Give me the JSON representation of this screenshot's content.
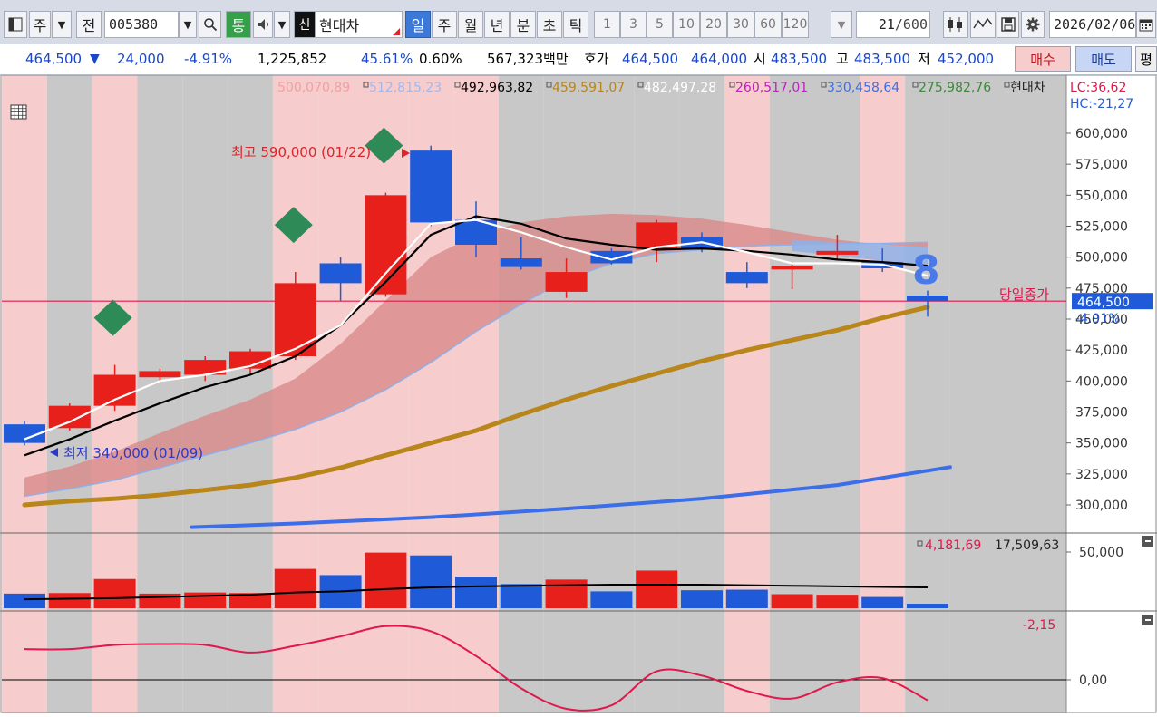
{
  "toolbar": {
    "period_select": "주",
    "prev_label": "전",
    "code_value": "005380",
    "tong_label": "통",
    "shin_badge": "신",
    "stock_name": "현대차",
    "period_tabs": [
      "일",
      "주",
      "월",
      "년",
      "분",
      "초",
      "틱"
    ],
    "active_tab": "일",
    "interval_buttons": [
      "1",
      "3",
      "5",
      "10",
      "20",
      "30",
      "60",
      "120"
    ],
    "count_value": "21",
    "count_max": "/600",
    "date_value": "2026/02/06"
  },
  "quote": {
    "price": "464,500",
    "change_arrow": "▼",
    "change": "24,000",
    "change_pct": "-4.91%",
    "volume": "1,225,852",
    "vol_ratio": "45.61%",
    "turnover": "0.60%",
    "amount": "567,323백만",
    "hoga_label": "호가",
    "ask": "464,500",
    "bid": "464,000",
    "open_label": "시",
    "open": "483,500",
    "high_label": "고",
    "high": "483,500",
    "low_label": "저",
    "low": "452,000",
    "buy_label": "매수",
    "sell_label": "매도",
    "extra_label": "평"
  },
  "colors": {
    "up": "#e8201c",
    "down": "#1f5ad8",
    "ma5": "#ffffff",
    "ma10": "#000000",
    "ma60": "#b8861a",
    "ma120": "#3b6ee8",
    "cloud": "#d98a8a",
    "band_pink": "#f6cccc",
    "band_gray": "#c8c8c8",
    "cci": "#e0184c"
  },
  "chart_data": {
    "type": "candlestick",
    "legend_values": [
      {
        "text": "500,070,89",
        "color": "#f0a0a0"
      },
      {
        "text": "512,815,23",
        "color": "#a0b8f0"
      },
      {
        "text": "492,963,82",
        "color": "#000000"
      },
      {
        "text": "459,591,07",
        "color": "#b8861a"
      },
      {
        "text": "482,497,28",
        "color": "#ffffff"
      },
      {
        "text": "260,517,01",
        "color": "#c020c0"
      },
      {
        "text": "330,458,64",
        "color": "#3b6ee8"
      },
      {
        "text": "275,982,76",
        "color": "#3a8a3a"
      }
    ],
    "legend_stock": "현대차",
    "lc_label": "LC:36,62",
    "hc_label": "HC:-21,27",
    "y_ticks": [
      600000,
      575000,
      550000,
      525000,
      500000,
      475000,
      450000,
      425000,
      400000,
      375000,
      350000,
      325000,
      300000
    ],
    "y_tick_labels": [
      "600,000",
      "575,000",
      "550,000",
      "525,000",
      "500,000",
      "475,000",
      "450,000",
      "425,000",
      "400,000",
      "375,000",
      "350,000",
      "325,000",
      "300,000"
    ],
    "ylim": [
      282000,
      623000
    ],
    "candles": [
      {
        "o": 365000,
        "h": 368000,
        "l": 348000,
        "c": 350000
      },
      {
        "o": 362000,
        "h": 382000,
        "l": 360000,
        "c": 380000
      },
      {
        "o": 380000,
        "h": 413000,
        "l": 376000,
        "c": 405000
      },
      {
        "o": 403000,
        "h": 410000,
        "l": 399000,
        "c": 408000
      },
      {
        "o": 405000,
        "h": 420000,
        "l": 400000,
        "c": 417000
      },
      {
        "o": 410000,
        "h": 426000,
        "l": 405000,
        "c": 424000
      },
      {
        "o": 420000,
        "h": 488000,
        "l": 417000,
        "c": 479000
      },
      {
        "o": 495000,
        "h": 500000,
        "l": 465000,
        "c": 479000
      },
      {
        "o": 470000,
        "h": 552000,
        "l": 468000,
        "c": 550000
      },
      {
        "o": 586000,
        "h": 590000,
        "l": 525000,
        "c": 528000
      },
      {
        "o": 530000,
        "h": 545000,
        "l": 500000,
        "c": 510000
      },
      {
        "o": 499000,
        "h": 516000,
        "l": 490000,
        "c": 492000
      },
      {
        "o": 472000,
        "h": 499000,
        "l": 467000,
        "c": 488000
      },
      {
        "o": 505000,
        "h": 507000,
        "l": 494000,
        "c": 495000
      },
      {
        "o": 506000,
        "h": 530000,
        "l": 496000,
        "c": 528000
      },
      {
        "o": 516000,
        "h": 520000,
        "l": 504000,
        "c": 506000
      },
      {
        "o": 488000,
        "h": 496000,
        "l": 475000,
        "c": 479000
      },
      {
        "o": 490000,
        "h": 496000,
        "l": 474000,
        "c": 493000
      },
      {
        "o": 502000,
        "h": 518000,
        "l": 498000,
        "c": 505000
      },
      {
        "o": 496000,
        "h": 507000,
        "l": 488000,
        "c": 491000
      },
      {
        "o": 469000,
        "h": 473000,
        "l": 452000,
        "c": 464500
      }
    ],
    "ma5": [
      353000,
      367000,
      385000,
      400000,
      405000,
      412000,
      426000,
      445000,
      487000,
      527000,
      530000,
      520000,
      508000,
      498000,
      508000,
      512000,
      504000,
      495000,
      495000,
      494000,
      485000
    ],
    "ma10": [
      340000,
      353000,
      368000,
      382000,
      395000,
      405000,
      420000,
      445000,
      480000,
      518000,
      533000,
      527000,
      515000,
      510000,
      506000,
      507000,
      505000,
      502000,
      498000,
      496000,
      493000
    ],
    "ma60": [
      300000,
      303000,
      305000,
      308000,
      312000,
      316000,
      322000,
      330000,
      340000,
      350000,
      360000,
      373000,
      385000,
      396000,
      406000,
      416000,
      425000,
      433000,
      441000,
      451000,
      459600
    ],
    "ma120": [
      {
        "i": 3.7,
        "v": 282000
      },
      {
        "i": 6,
        "v": 285000
      },
      {
        "i": 9,
        "v": 290000
      },
      {
        "i": 12,
        "v": 297000
      },
      {
        "i": 15,
        "v": 305000
      },
      {
        "i": 18,
        "v": 316000
      },
      {
        "i": 20.5,
        "v": 330500
      }
    ],
    "cloud_upper": [
      322000,
      331000,
      343000,
      358000,
      372000,
      385000,
      402000,
      430000,
      465000,
      500000,
      518000,
      528000,
      533000,
      535000,
      534000,
      531000,
      526000,
      520000,
      514000,
      510000,
      508000
    ],
    "cloud_lower": [
      307000,
      313000,
      320000,
      330000,
      340000,
      350000,
      361000,
      375000,
      393000,
      415000,
      440000,
      462000,
      482000,
      495000,
      503000,
      506000,
      509000,
      510000,
      511000,
      511000,
      512000
    ],
    "band_pattern": [
      "pink",
      "gray",
      "pink",
      "gray",
      "gray",
      "gray",
      "pink",
      "pink",
      "pink",
      "pink",
      "pink",
      "gray",
      "gray",
      "gray",
      "gray",
      "gray",
      "pink",
      "gray",
      "gray",
      "pink",
      "gray"
    ],
    "signal_diamonds": [
      2,
      6,
      8
    ],
    "high_annotation": "최고 590,000 (01/22)",
    "low_annotation": "최저 340,000 (01/09)",
    "count_marker": "8",
    "today_close_label": "당일종가",
    "current_price_label": "464,500",
    "current_change_label": "-4.91%",
    "current_price": 464500,
    "volume_panel": {
      "legend_prev": "4,181,69",
      "legend_val": "17,509,63",
      "y_tick_label": "50,000",
      "ymax": 50000,
      "bars": [
        13000,
        13500,
        26000,
        13000,
        14000,
        13500,
        35000,
        29500,
        49500,
        47000,
        28000,
        21500,
        25500,
        15000,
        33500,
        16000,
        16500,
        12500,
        12000,
        10000,
        4000
      ],
      "ma": [
        8000,
        8500,
        9000,
        10000,
        11000,
        12000,
        14000,
        15000,
        17000,
        18500,
        19500,
        20000,
        20500,
        21000,
        21000,
        21000,
        20500,
        20000,
        19500,
        19000,
        18500
      ]
    },
    "cci_panel": {
      "legend_value": "-2,15",
      "zero_label": "0,00",
      "values": [
        36,
        36,
        41,
        42,
        41,
        32,
        40,
        51,
        63,
        57,
        28,
        -10,
        -34,
        -30,
        10,
        5,
        -13,
        -22,
        -3,
        2,
        -24
      ]
    }
  }
}
